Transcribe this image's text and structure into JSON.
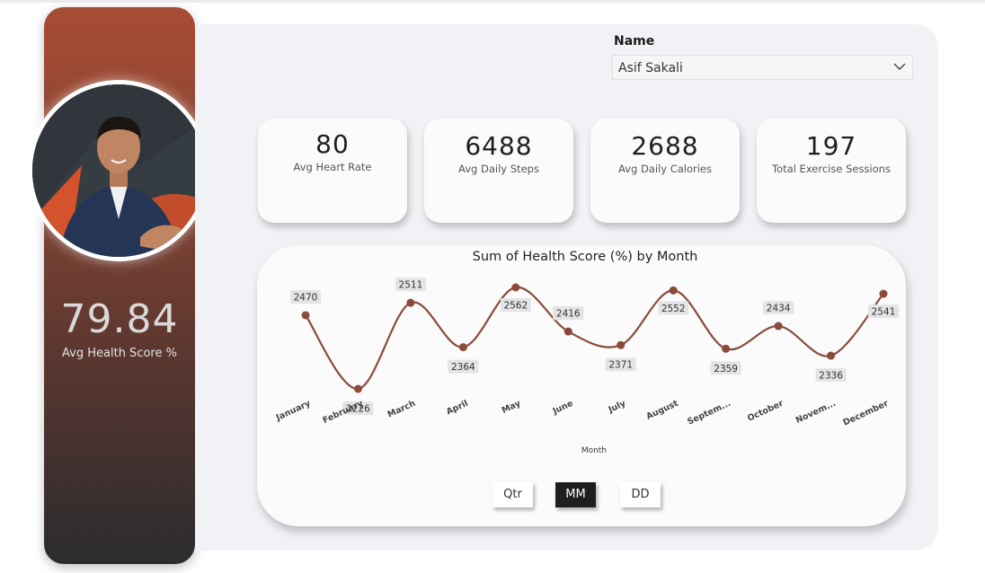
{
  "profile": {
    "avg_health_score": "79.84",
    "avg_health_score_label": "Avg Health Score %"
  },
  "filter": {
    "label": "Name",
    "selected": "Asif Sakali"
  },
  "kpis": [
    {
      "value": "80",
      "label": "Avg Heart Rate"
    },
    {
      "value": "6488",
      "label": "Avg Daily Steps"
    },
    {
      "value": "2688",
      "label": "Avg Daily Calories"
    },
    {
      "value": "197",
      "label": "Total Exercise Sessions"
    }
  ],
  "chart_data": {
    "type": "line",
    "title": "Sum of Health Score (%) by Month",
    "xlabel": "Month",
    "ylabel": "",
    "categories": [
      "January",
      "February",
      "March",
      "April",
      "May",
      "June",
      "July",
      "August",
      "Septem...",
      "October",
      "Novem...",
      "December"
    ],
    "values": [
      2470,
      2226,
      2511,
      2364,
      2562,
      2416,
      2371,
      2552,
      2359,
      2434,
      2336,
      2541
    ],
    "ylim": [
      2226,
      2562
    ],
    "grid": false,
    "line_color": "#8b4a3a",
    "smooth": true
  },
  "toggles": [
    {
      "label": "Qtr",
      "active": false
    },
    {
      "label": "MM",
      "active": true
    },
    {
      "label": "DD",
      "active": false
    }
  ],
  "colors": {
    "accent": "#8b4a3a",
    "panel_top": "#a84c34",
    "panel_bottom": "#2b2b2e"
  }
}
